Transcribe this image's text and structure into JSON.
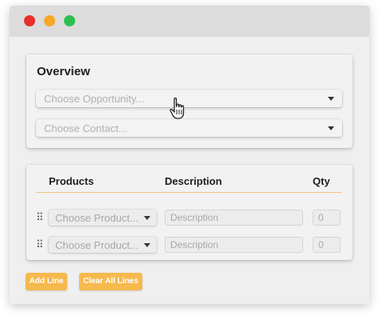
{
  "window": {
    "controls": [
      "close",
      "minimize",
      "maximize"
    ]
  },
  "overview": {
    "title": "Overview",
    "opportunity_placeholder": "Choose Opportunity...",
    "contact_placeholder": "Choose Contact..."
  },
  "products": {
    "headers": {
      "products": "Products",
      "description": "Description",
      "qty": "Qty"
    },
    "rows": [
      {
        "product_placeholder": "Choose Product...",
        "description_placeholder": "Description",
        "qty_placeholder": "0"
      },
      {
        "product_placeholder": "Choose Product...",
        "description_placeholder": "Description",
        "qty_placeholder": "0"
      }
    ]
  },
  "actions": {
    "add_line": "Add Line",
    "clear_all_lines": "Clear All Lines"
  },
  "colors": {
    "accent": "#f5b94d",
    "close": "#e8302a",
    "minimize": "#f4a928",
    "maximize": "#2ec04f"
  },
  "icons": {
    "cursor": "hand-pointer-icon",
    "drag": "drag-handle-icon",
    "caret": "caret-down-icon"
  }
}
